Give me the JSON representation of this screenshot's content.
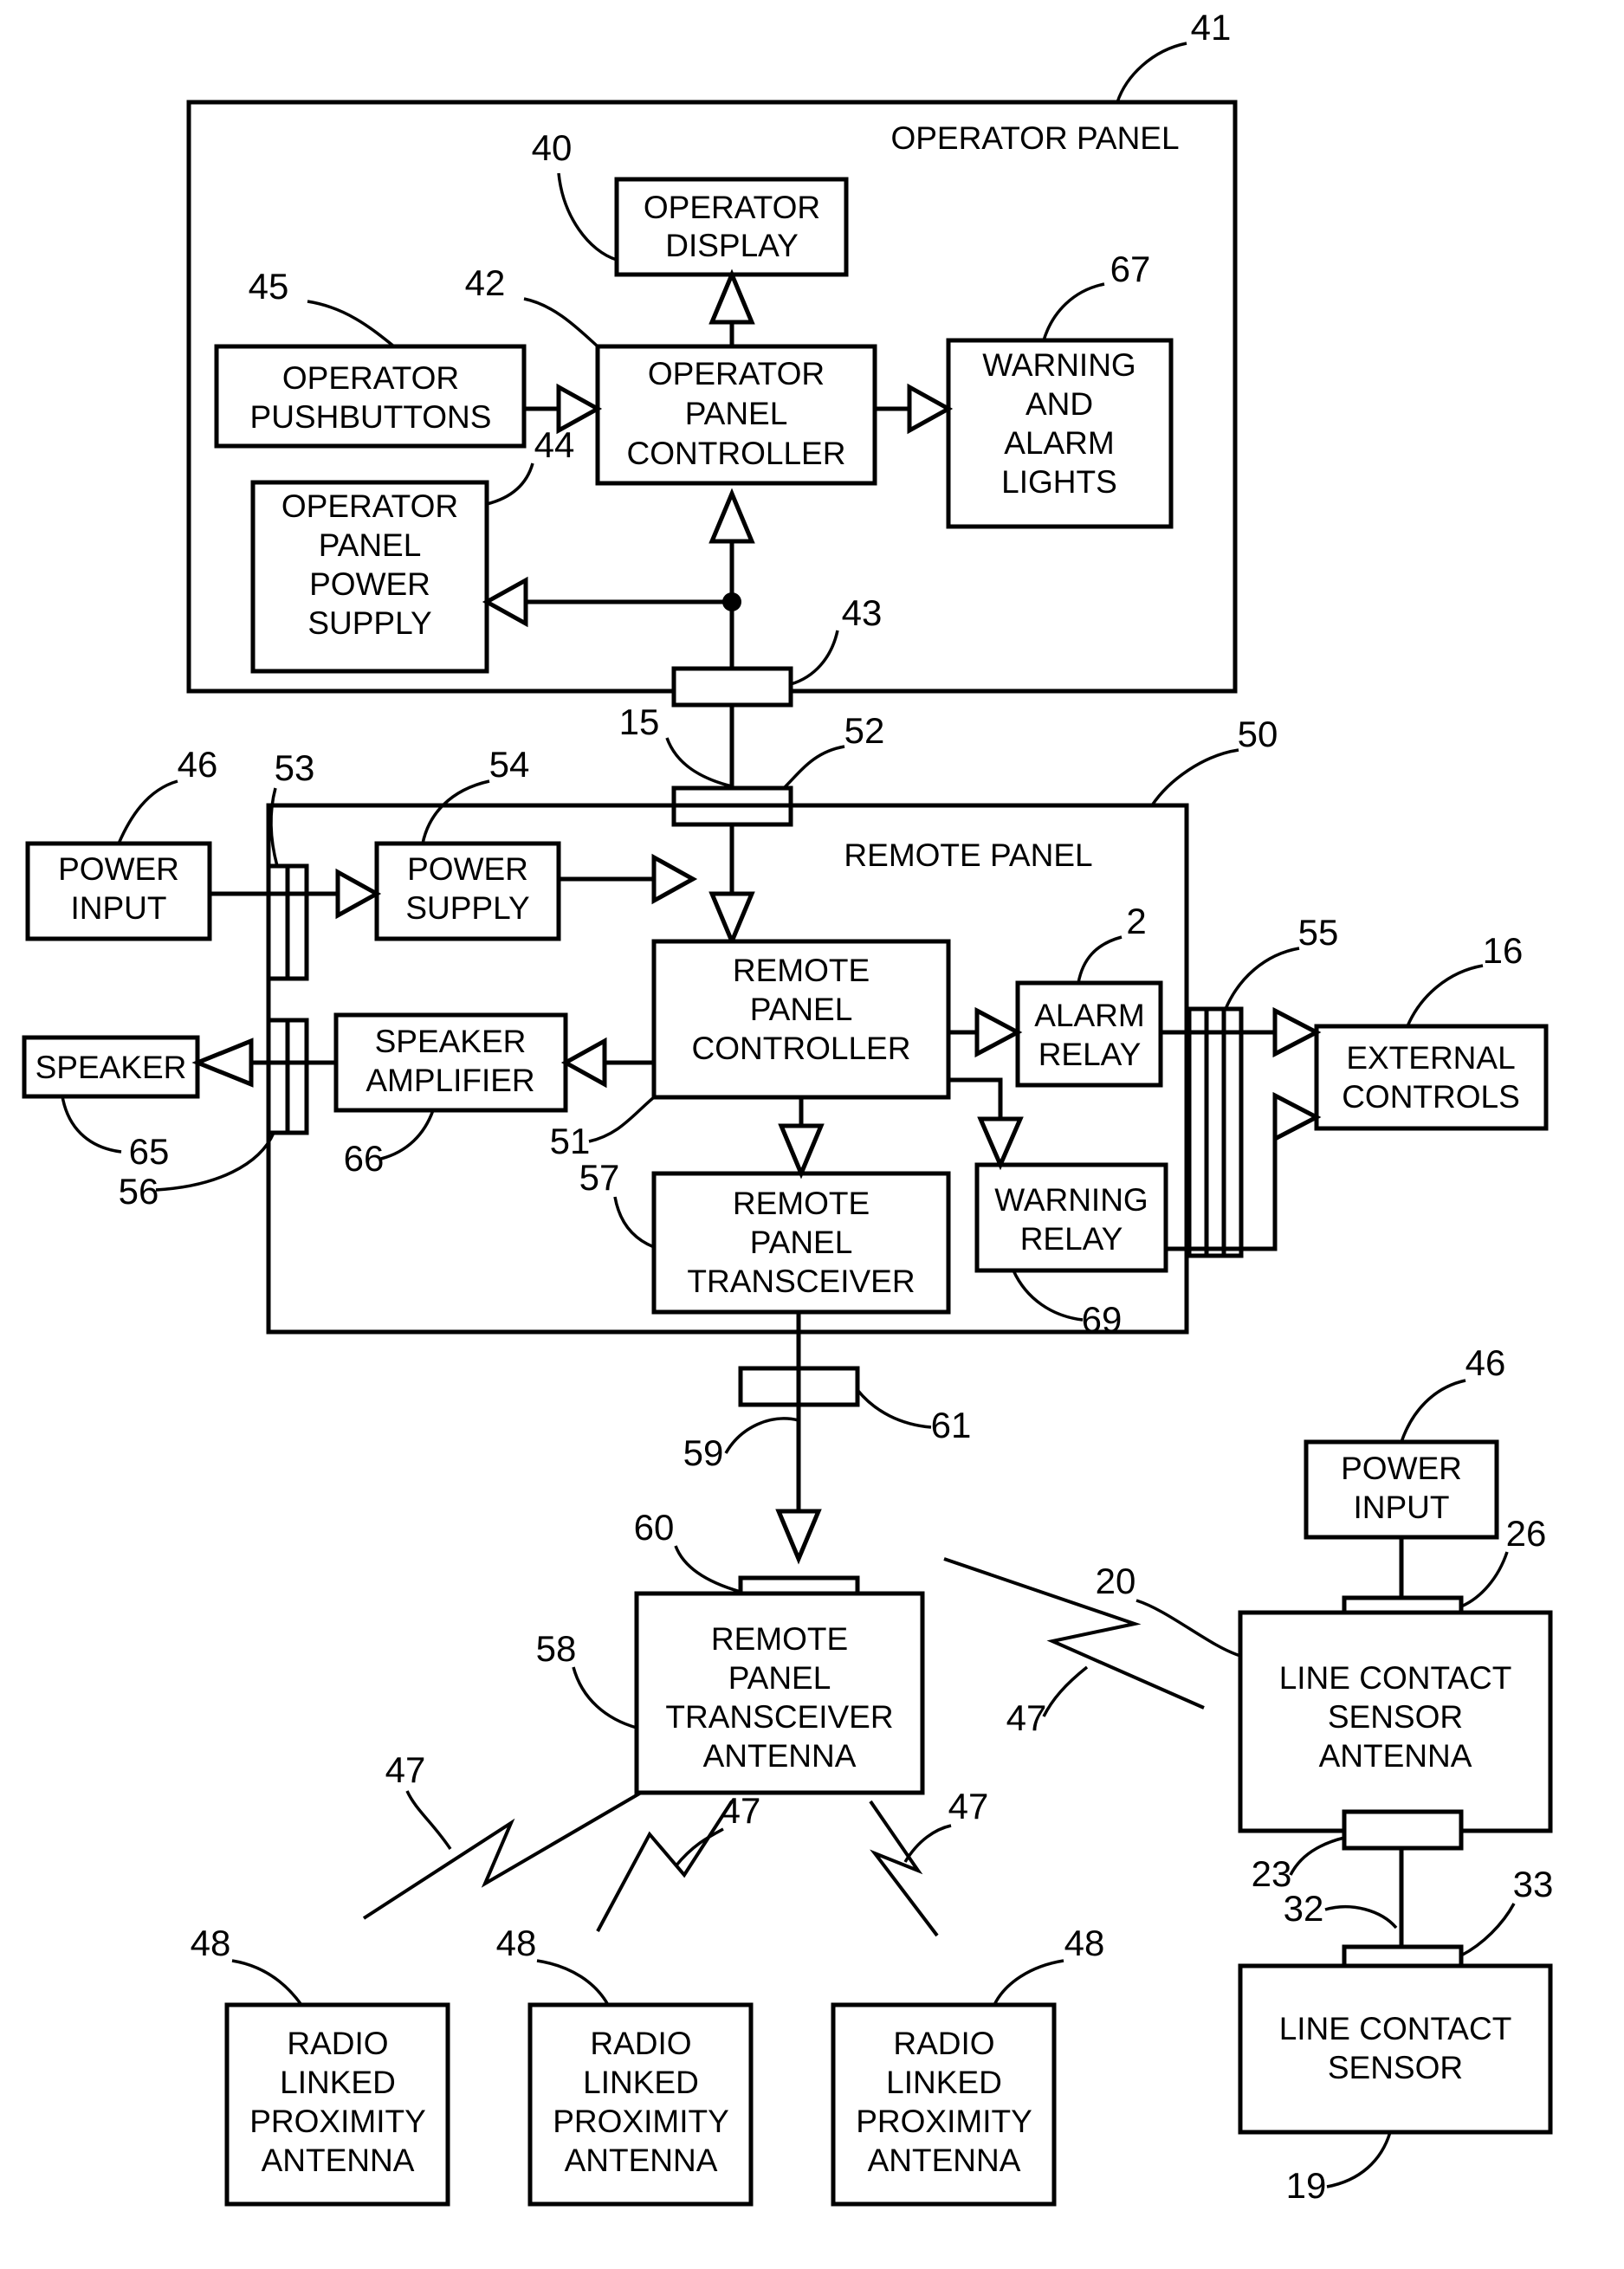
{
  "figure": {
    "type": "patent-block-diagram",
    "title_blocks": {
      "operator_panel": "OPERATOR PANEL",
      "remote_panel": "REMOTE PANEL"
    }
  },
  "blocks": {
    "operator_display": "OPERATOR\nDISPLAY",
    "operator_pushbuttons": "OPERATOR\nPUSHBUTTONS",
    "operator_panel_controller": "OPERATOR\nPANEL\nCONTROLLER",
    "warning_and_alarm_lights": "WARNING\nAND\nALARM\nLIGHTS",
    "operator_panel_power_supply": "OPERATOR\nPANEL\nPOWER\nSUPPLY",
    "power_input_left": "POWER\nINPUT",
    "power_supply": "POWER\nSUPPLY",
    "speaker": "SPEAKER",
    "speaker_amplifier": "SPEAKER\nAMPLIFIER",
    "remote_panel_controller": "REMOTE\nPANEL\nCONTROLLER",
    "alarm_relay": "ALARM\nRELAY",
    "warning_relay": "WARNING\nRELAY",
    "external_controls": "EXTERNAL\nCONTROLS",
    "remote_panel_transceiver": "REMOTE\nPANEL\nTRANSCEIVER",
    "remote_panel_transceiver_antenna": "REMOTE\nPANEL\nTRANSCEIVER\nANTENNA",
    "power_input_right": "POWER\nINPUT",
    "line_contact_sensor_antenna": "LINE CONTACT\nSENSOR\nANTENNA",
    "line_contact_sensor": "LINE CONTACT\nSENSOR",
    "radio_linked_proximity_antenna_1": "RADIO\nLINKED\nPROXIMITY\nANTENNA",
    "radio_linked_proximity_antenna_2": "RADIO\nLINKED\nPROXIMITY\nANTENNA",
    "radio_linked_proximity_antenna_3": "RADIO\nLINKED\nPROXIMITY\nANTENNA"
  },
  "reference_numerals": {
    "n41": "41",
    "n40": "40",
    "n45": "45",
    "n42": "42",
    "n67": "67",
    "n44": "44",
    "n43": "43",
    "n15": "15",
    "n46a": "46",
    "n53": "53",
    "n54": "54",
    "n52": "52",
    "n50": "50",
    "n2": "2",
    "n55": "55",
    "n16": "16",
    "n65": "65",
    "n66": "66",
    "n56": "56",
    "n51": "51",
    "n57": "57",
    "n69": "69",
    "n59": "59",
    "n61": "61",
    "n60": "60",
    "n58": "58",
    "n20": "20",
    "n46b": "46",
    "n26": "26",
    "n23": "23",
    "n32": "32",
    "n33": "33",
    "n19": "19",
    "n47a": "47",
    "n47b": "47",
    "n47c": "47",
    "n47d": "47",
    "n47e": "47",
    "n48a": "48",
    "n48b": "48",
    "n48c": "48"
  }
}
